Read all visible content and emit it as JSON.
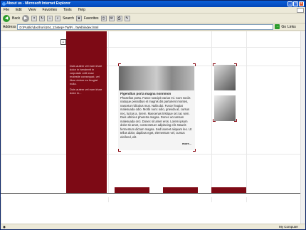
{
  "window": {
    "title": "About us - Microsoft Internet Explorer"
  },
  "menu": {
    "items": [
      "File",
      "Edit",
      "View",
      "Favorites",
      "Tools",
      "Help"
    ]
  },
  "toolbar": {
    "back_label": "Back",
    "search_label": "Search",
    "favorites_label": "Favorites"
  },
  "address": {
    "label": "Address",
    "value": "D:\\Public\\doc\\hon\\104_11\\step+7WiFi...\\Web\\index.html",
    "go_label": "Go",
    "links_label": "Links"
  },
  "page": {
    "sidebar_text_1": "Duis autem vel eum iriure dolor in hendrerit in vulputate velit esse molestie consequat, vel illum dolore eu feugiat nulla.",
    "sidebar_text_2": "Duis autem vel eum iriure dolor in...",
    "article_head": "Figendius porta magna nonnmon",
    "article_body": "Phasellus porta. Fusce suscipit varius mi. Cum sociis natoque penatibus et magnis dis parturient montes, nascetur ridiculus mus. Nulla dui. Fusce feugiat malesuada odio. Morbi nunc odio, gravida at, cursus nec, luctus a, lorem. Maecenas tristique orci ac sem. Duis ultricies pharetra magna. Donec accumsan malesuada orci. Donec sit amet eros. Lorem ipsum dolor sit amet, consectetuer adipiscing elit. Mauris fermentum dictum magna. Sed laoreet aliquam leo. Ut tellus dolor, dapibus eget, elementum vel, cursus eleifend, elit.",
    "more_label": "more..."
  },
  "status": {
    "zone": "My Computer"
  }
}
